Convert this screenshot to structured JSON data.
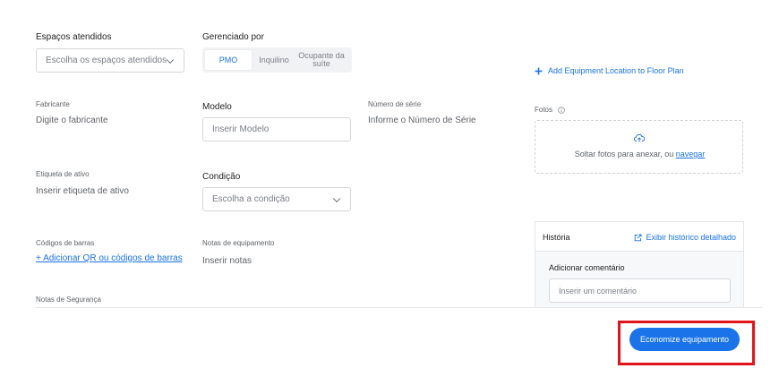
{
  "fields": {
    "spaces": {
      "label": "Espaços atendidos",
      "placeholder": "Escolha os espaços atendidos"
    },
    "managed_by": {
      "label": "Gerenciado por",
      "options": [
        "PMO",
        "Inquilino",
        "Ocupante da suíte"
      ],
      "selected": "PMO"
    },
    "manufacturer": {
      "label": "Fabricante",
      "placeholder": "Digite o fabricante"
    },
    "model": {
      "label": "Modelo",
      "placeholder": "Inserir Modelo"
    },
    "serial": {
      "label": "Número de série",
      "placeholder": "Informe o Número de Série"
    },
    "asset_tag": {
      "label": "Etiqueta de ativo",
      "placeholder": "Inserir etiqueta de ativo"
    },
    "condition": {
      "label": "Condição",
      "placeholder": "Escolha a condição"
    },
    "barcodes": {
      "label": "Códigos de barras",
      "link": "+ Adicionar QR ou códigos de barras"
    },
    "equipment_notes": {
      "label": "Notas de equipamento",
      "placeholder": "Inserir notas"
    },
    "safety_notes": {
      "label": "Notas de Segurança"
    }
  },
  "floorplan": {
    "link": "Add Equipment Location to Floor Plan",
    "icon": "plus-icon"
  },
  "photos": {
    "label": "Fotos",
    "drop_text": "Soltar fotos para anexar, ou ",
    "browse": "navegar"
  },
  "history": {
    "title": "História",
    "detail_link": "Exibir histórico detalhado",
    "comment_label": "Adicionar comentário",
    "comment_placeholder": "Inserir um comentário"
  },
  "footer": {
    "save_label": "Economize equipamento"
  },
  "colors": {
    "accent": "#1a73e8",
    "highlight": "#e2131b"
  }
}
